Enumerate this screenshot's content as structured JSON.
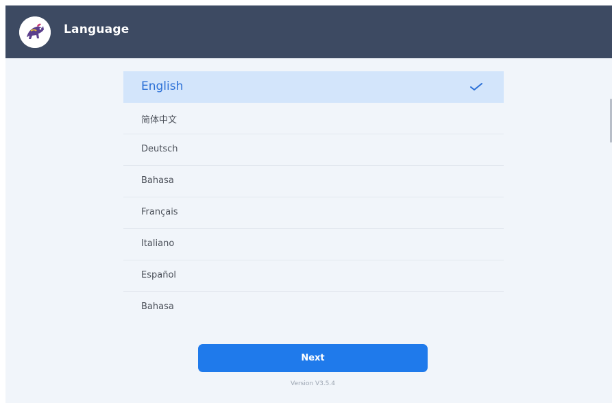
{
  "header": {
    "title": "Language",
    "logo_icon": "circus-horse-logo-icon"
  },
  "languages": [
    {
      "label": "English",
      "selected": true
    },
    {
      "label": "简体中文",
      "selected": false
    },
    {
      "label": "Deutsch",
      "selected": false
    },
    {
      "label": "Bahasa",
      "selected": false
    },
    {
      "label": "Français",
      "selected": false
    },
    {
      "label": "Italiano",
      "selected": false
    },
    {
      "label": "Español",
      "selected": false
    },
    {
      "label": "Bahasa",
      "selected": false
    }
  ],
  "selected_check_icon": "checkmark-icon",
  "actions": {
    "next_label": "Next"
  },
  "footer": {
    "version": "Version V3.5.4"
  },
  "colors": {
    "header_bg": "#3d4a62",
    "page_bg": "#f1f5fa",
    "selected_row_bg": "#d3e5fb",
    "accent": "#2a6fd6",
    "button_bg": "#1f7aeb"
  }
}
